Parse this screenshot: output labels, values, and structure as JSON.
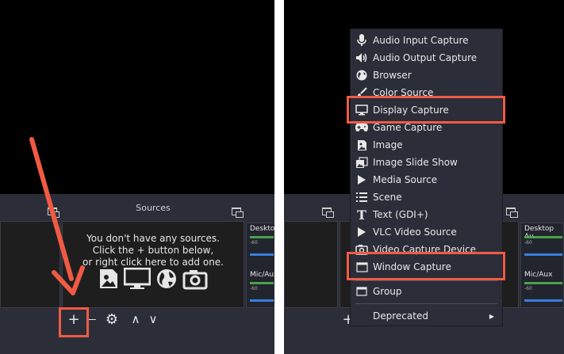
{
  "left": {
    "sources_title": "Sources",
    "empty_line1": "You don't have any sources.",
    "empty_line2": "Click the + button below,",
    "empty_line3": "or right click here to add one.",
    "toolbar": {
      "add": "+",
      "remove": "—",
      "settings": "⚙",
      "up": "∧",
      "down": "∨"
    },
    "mixer": {
      "desktop_label": "Desktop",
      "mic_label": "Mic/Aux",
      "scale_label": "-60"
    },
    "source_icons": [
      "image-icon",
      "display-icon",
      "globe-icon",
      "camera-icon"
    ]
  },
  "right": {
    "toolbar": {
      "add": "+"
    },
    "mixer": {
      "desktop_label": "Desktop Au",
      "mic_label": "Mic/Aux",
      "scale_label": "-60"
    },
    "menu": {
      "items": [
        {
          "label": "Audio Input Capture",
          "icon": "microphone-icon"
        },
        {
          "label": "Audio Output Capture",
          "icon": "speaker-icon"
        },
        {
          "label": "Browser",
          "icon": "globe-icon"
        },
        {
          "label": "Color Source",
          "icon": "brush-icon"
        },
        {
          "label": "Display Capture",
          "icon": "monitor-icon"
        },
        {
          "label": "Game Capture",
          "icon": "gamepad-icon"
        },
        {
          "label": "Image",
          "icon": "image-icon"
        },
        {
          "label": "Image Slide Show",
          "icon": "slideshow-icon"
        },
        {
          "label": "Media Source",
          "icon": "play-icon"
        },
        {
          "label": "Scene",
          "icon": "list-icon"
        },
        {
          "label": "Text (GDI+)",
          "icon": "text-icon"
        },
        {
          "label": "VLC Video Source",
          "icon": "play-icon"
        },
        {
          "label": "Video Capture Device",
          "icon": "camera-icon"
        },
        {
          "label": "Window Capture",
          "icon": "window-icon"
        }
      ],
      "group_label": "Group",
      "deprecated_label": "Deprecated",
      "submenu_arrow": "▶"
    }
  },
  "colors": {
    "highlight": "#f05a44",
    "panel_bg": "#2b2e38",
    "dock_bg": "#1f1e1f"
  }
}
